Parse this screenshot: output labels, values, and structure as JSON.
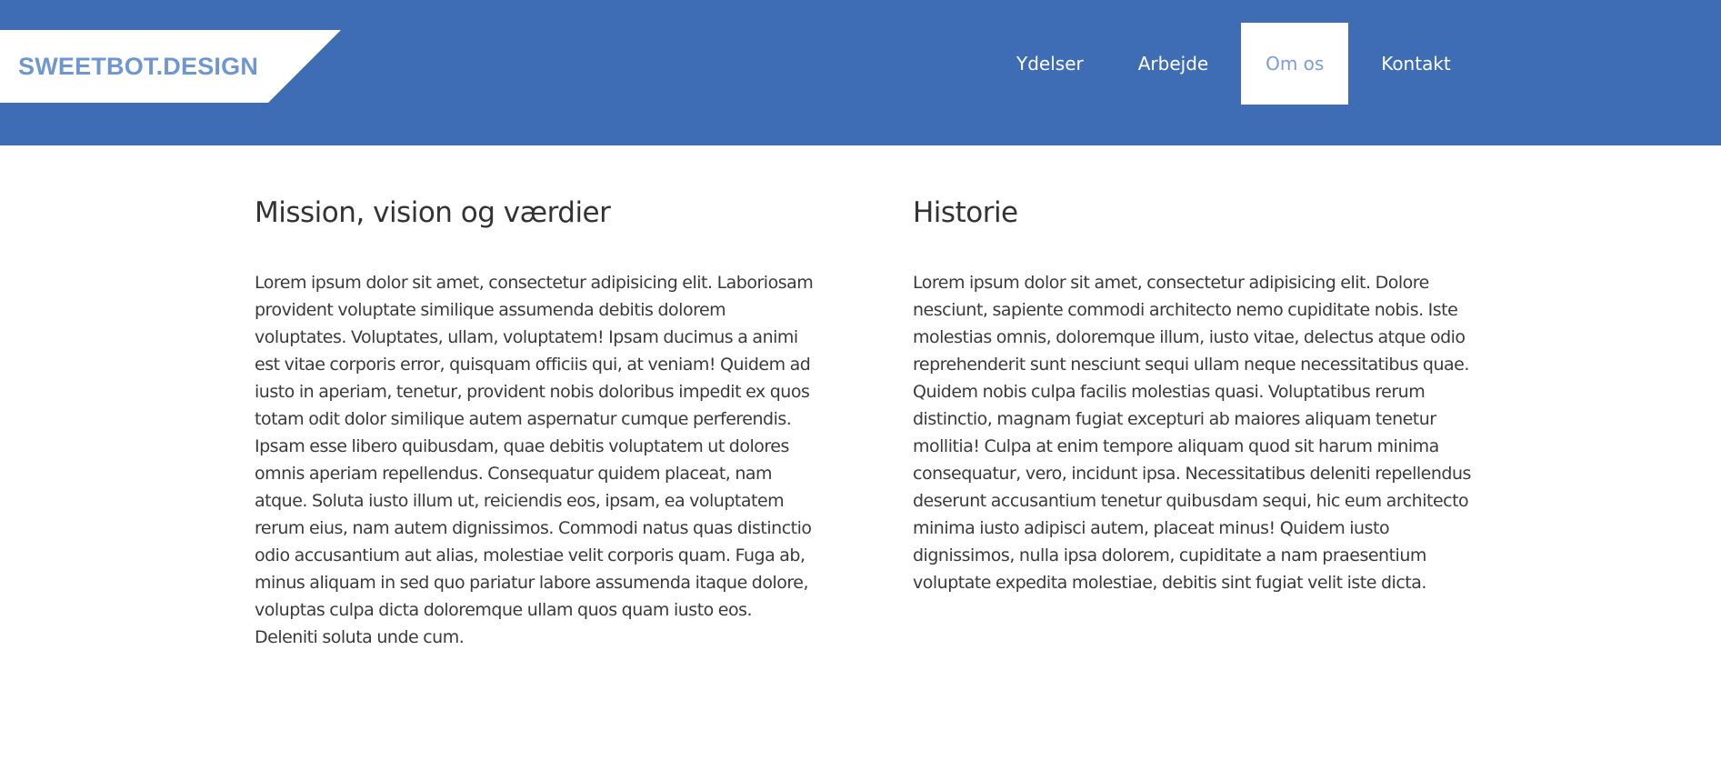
{
  "header": {
    "logo": "SWEETBOT.DESIGN",
    "nav": [
      {
        "label": "Ydelser"
      },
      {
        "label": "Arbejde"
      },
      {
        "label": "Om os",
        "active": true
      },
      {
        "label": "Kontakt"
      }
    ]
  },
  "colors": {
    "header_bg": "#3e6db5",
    "logo_text": "#6f97cf",
    "active_nav_text": "#7a9ed3",
    "body_text": "#333333"
  },
  "main": {
    "left": {
      "heading": "Mission, vision og værdier",
      "body": "Lorem ipsum dolor sit amet, consectetur adipisicing elit. Laboriosam provident voluptate similique assumenda debitis dolorem voluptates. Voluptates, ullam, voluptatem! Ipsam ducimus a animi est vitae corporis error, quisquam officiis qui, at veniam! Quidem ad iusto in aperiam, tenetur, provident nobis doloribus impedit ex quos totam odit dolor similique autem aspernatur cumque perferendis. Ipsam esse libero quibusdam, quae debitis voluptatem ut dolores omnis aperiam repellendus. Consequatur quidem placeat, nam atque. Soluta iusto illum ut, reiciendis eos, ipsam, ea voluptatem rerum eius, nam autem dignissimos. Commodi natus quas distinctio odio accusantium aut alias, molestiae velit corporis quam. Fuga ab, minus aliquam in sed quo pariatur labore assumenda itaque dolore, voluptas culpa dicta doloremque ullam quos quam iusto eos. Deleniti soluta unde cum."
    },
    "right": {
      "heading": "Historie",
      "body": "Lorem ipsum dolor sit amet, consectetur adipisicing elit. Dolore nesciunt, sapiente commodi architecto nemo cupiditate nobis. Iste molestias omnis, doloremque illum, iusto vitae, delectus atque odio reprehenderit sunt nesciunt sequi ullam neque necessitatibus quae. Quidem nobis culpa facilis molestias quasi. Voluptatibus rerum distinctio, magnam fugiat excepturi ab maiores aliquam tenetur mollitia! Culpa at enim tempore aliquam quod sit harum minima consequatur, vero, incidunt ipsa. Necessitatibus deleniti repellendus deserunt accusantium tenetur quibusdam sequi, hic eum architecto minima iusto adipisci autem, placeat minus! Quidem iusto dignissimos, nulla ipsa dolorem, cupiditate a nam praesentium voluptate expedita molestiae, debitis sint fugiat velit iste dicta."
    }
  }
}
